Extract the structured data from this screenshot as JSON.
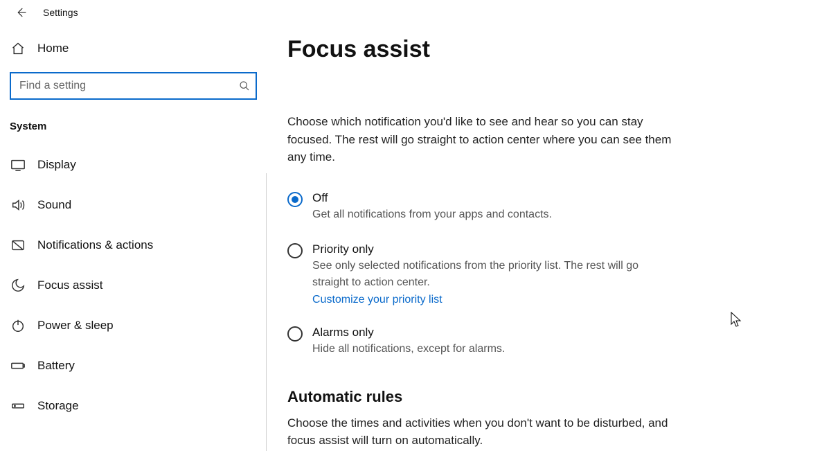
{
  "window": {
    "title": "Settings"
  },
  "sidebar": {
    "home_label": "Home",
    "search_placeholder": "Find a setting",
    "category": "System",
    "items": [
      {
        "label": "Display",
        "icon": "display-icon"
      },
      {
        "label": "Sound",
        "icon": "sound-icon"
      },
      {
        "label": "Notifications & actions",
        "icon": "notifications-icon"
      },
      {
        "label": "Focus assist",
        "icon": "moon-icon"
      },
      {
        "label": "Power & sleep",
        "icon": "power-icon"
      },
      {
        "label": "Battery",
        "icon": "battery-icon"
      },
      {
        "label": "Storage",
        "icon": "storage-icon"
      }
    ]
  },
  "page": {
    "title": "Focus assist",
    "description": "Choose which notification you'd like to see and hear so you can stay focused. The rest will go straight to action center where you can see them any time.",
    "options": [
      {
        "label": "Off",
        "sub": "Get all notifications from your apps and contacts.",
        "selected": true
      },
      {
        "label": "Priority only",
        "sub": "See only selected notifications from the priority list. The rest will go straight to action center.",
        "link": "Customize your priority list",
        "selected": false
      },
      {
        "label": "Alarms only",
        "sub": "Hide all notifications, except for alarms.",
        "selected": false
      }
    ],
    "auto_rules_header": "Automatic rules",
    "auto_rules_desc": "Choose the times and activities when you don't want to be disturbed, and focus assist will turn on automatically."
  }
}
